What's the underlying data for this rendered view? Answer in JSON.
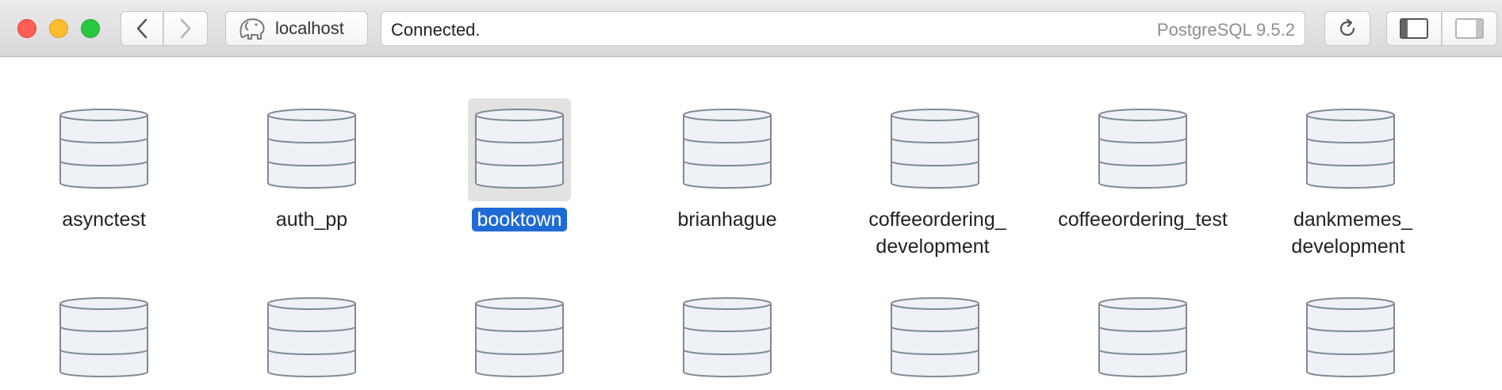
{
  "window": {
    "host_label": "localhost",
    "status_text": "Connected.",
    "server_version": "PostgreSQL 9.5.2"
  },
  "toolbar": {
    "icons": [
      "chevron-left-icon",
      "chevron-right-icon",
      "elephant-icon",
      "reload-icon",
      "sidebar-left-icon",
      "sidebar-right-icon"
    ]
  },
  "databases": [
    {
      "name": "asynctest",
      "selected": false
    },
    {
      "name": "auth_pp",
      "selected": false
    },
    {
      "name": "booktown",
      "selected": true
    },
    {
      "name": "brianhague",
      "selected": false
    },
    {
      "name": "coffeeordering_\ndevelopment",
      "selected": false
    },
    {
      "name": "coffeeordering_test",
      "selected": false
    },
    {
      "name": "dankmemes_\ndevelopment",
      "selected": false
    }
  ],
  "colors": {
    "selection": "#1f6bd6",
    "db_fill": "#eef2f6",
    "db_stroke": "#7f8a93"
  }
}
